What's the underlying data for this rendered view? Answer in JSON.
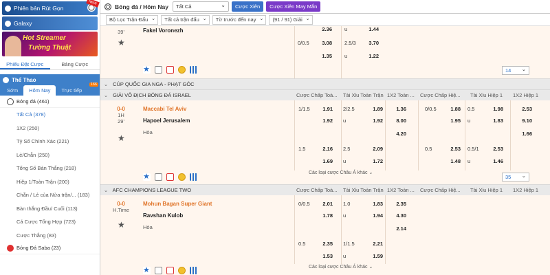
{
  "sidebar": {
    "promo_label": "Phiên bản Rút Gọn",
    "promo_badge": "NEW",
    "galaxy_label": "Galaxy",
    "banner_line1": "Hot Streamer",
    "banner_line2": "Tường Thuật",
    "tabs": [
      "Phiếu Đặt Cược",
      "Bảng Cược"
    ],
    "sport_label": "Thể Thao",
    "sub_tabs": [
      "Sớm",
      "Hôm Nay",
      "Trực tiếp"
    ],
    "sub_badge": "166",
    "football": "Bóng đá  (461)",
    "items": [
      "Tất Cả (378)",
      "1X2 (250)",
      "Tỷ Số Chính Xác (221)",
      "Lẻ/Chẵn (250)",
      "Tổng Số Bàn Thắng (218)",
      "Hiệp 1/Toàn Trận (200)",
      "Chẵn / Lẻ của Nửa trận/... (183)",
      "Bàn thắng Đầu/ Cuối (113)",
      "Cá Cược Tổng Hợp (723)",
      "Cược Thắng (83)"
    ],
    "saba": "Bóng Đá Saba  (23)"
  },
  "topbar": {
    "title": "Bóng đá / Hôm Nay",
    "select": "Tất Cả",
    "btn1": "Cược Xiên",
    "btn2": "Cược Xiên May Mắn"
  },
  "filters": [
    "Bộ Lọc Trận Đấu",
    "Tất cả trận đấu",
    "Từ trước đến nay",
    "(91 / 91) Giải"
  ],
  "headers": [
    "Cược Chấp Toà...",
    "Tài Xỉu Toàn Trận",
    "1X2 Toàn ...",
    "Cược Chấp Hiệ...",
    "Tài Xỉu Hiệp 1",
    "1X2 Hiệp 1"
  ],
  "m0": {
    "time": "39'",
    "team": "Fakel Voronezh",
    "r1": [
      "",
      "2.36",
      "u",
      "1.44"
    ],
    "r2": [
      "0/0.5",
      "3.08",
      "2.5/3",
      "3.70"
    ],
    "r3": [
      "",
      "1.35",
      "u",
      "1.22"
    ],
    "pager": "14"
  },
  "league1": "CÚP QUỐC GIA NGA - PHẠT GÓC",
  "league2": "GIẢI VÔ ĐỊCH BÓNG ĐÁ ISRAEL",
  "m1": {
    "score": "0-0",
    "half": "1H",
    "time": "29'",
    "home": "Maccabi Tel Aviv",
    "away": "Hapoel Jerusalem",
    "draw": "Hòa",
    "r1": [
      "1/1.5",
      "1.91",
      "2/2.5",
      "1.89",
      "1.36",
      "0/0.5",
      "1.88",
      "0.5",
      "1.98",
      "2.53"
    ],
    "r2": [
      "",
      "1.92",
      "u",
      "1.92",
      "8.00",
      "",
      "1.95",
      "u",
      "1.83",
      "9.10"
    ],
    "r3": [
      "4.20",
      "1.66"
    ],
    "r4": [
      "1.5",
      "2.16",
      "2.5",
      "2.09",
      "0.5",
      "2.53",
      "0.5/1",
      "2.53"
    ],
    "r5": [
      "",
      "1.69",
      "u",
      "1.72",
      "",
      "1.48",
      "u",
      "1.46"
    ],
    "more": "Các loại cược Châu Á khác",
    "pager": "35"
  },
  "league3": "AFC CHAMPIONS LEAGUE TWO",
  "m2": {
    "score": "0-0",
    "half": "H.Time",
    "home": "Mohun Bagan Super Giant",
    "away": "Ravshan Kulob",
    "draw": "Hòa",
    "r1": [
      "0/0.5",
      "2.01",
      "1.0",
      "1.83",
      "2.35"
    ],
    "r2": [
      "",
      "1.78",
      "u",
      "1.94",
      "4.30"
    ],
    "r3": [
      "2.14"
    ],
    "r4": [
      "0.5",
      "2.35",
      "1/1.5",
      "2.21"
    ],
    "r5": [
      "",
      "1.53",
      "u",
      "1.59"
    ],
    "more": "Các loại cược Châu Á khác"
  }
}
